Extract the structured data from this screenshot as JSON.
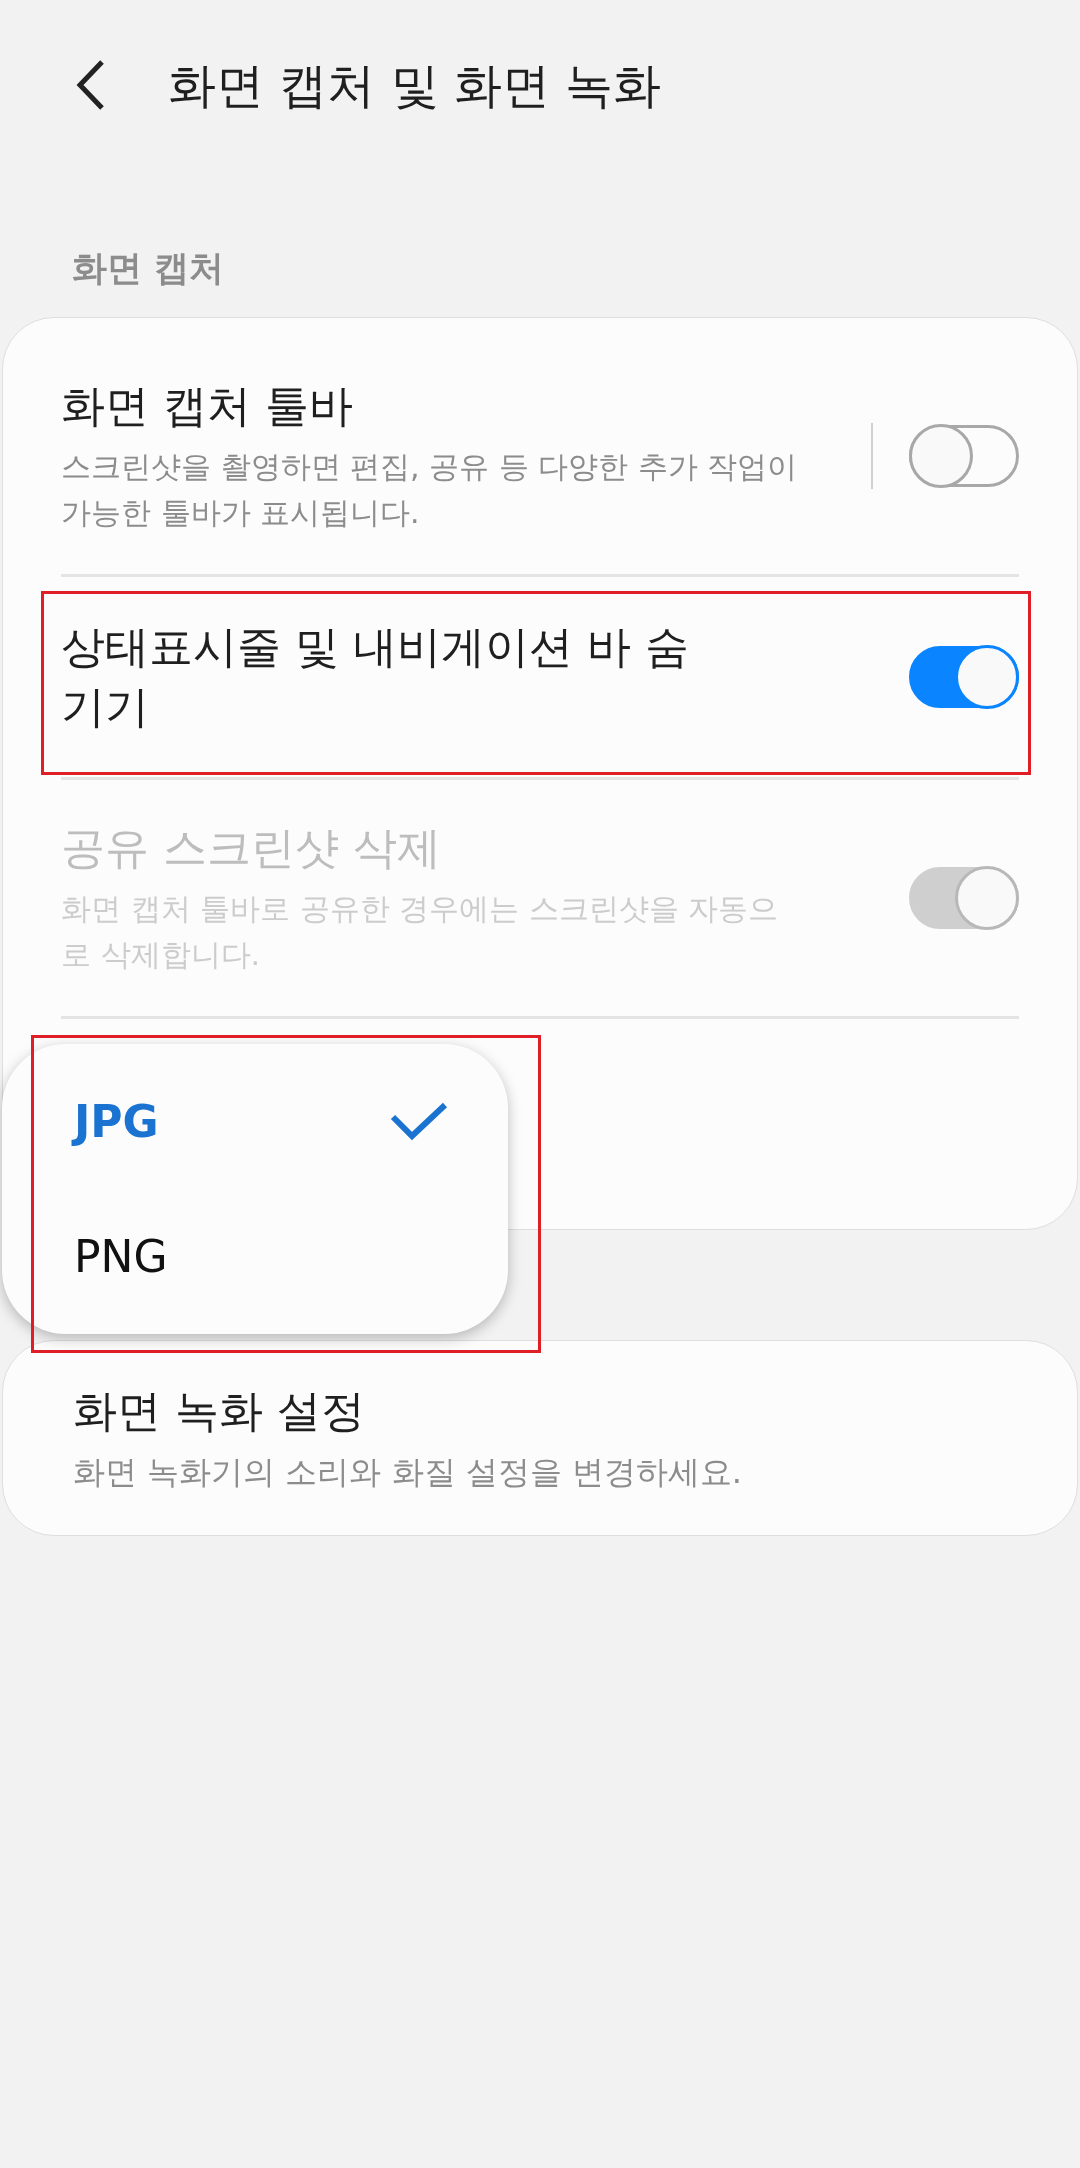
{
  "header": {
    "title": "화면 캡처 및 화면 녹화"
  },
  "sections": [
    {
      "label": "화면 캡처",
      "items": [
        {
          "title": "화면 캡처 툴바",
          "summary": "스크린샷을 촬영하면 편집, 공유 등 다양한 추가 작업이 가능한 툴바가 표시됩니다.",
          "on": false,
          "disabled": false,
          "highlighted": false,
          "divider": true
        },
        {
          "title": "상태표시줄 및 내비게이션 바 숨기기",
          "on": true,
          "disabled": false,
          "highlighted": true,
          "divider": false
        },
        {
          "title": "공유 스크린샷 삭제",
          "summary": "화면 캡처 툴바로 공유한 경우에는 스크린샷을 자동으로 삭제합니다.",
          "on": true,
          "disabled": true,
          "highlighted": false,
          "divider": false
        }
      ]
    },
    {
      "items": [
        {
          "title": "화면 녹화 설정",
          "summary": "화면 녹화기의 소리와 화질 설정을 변경하세요."
        }
      ]
    }
  ],
  "popup": {
    "highlighted": true,
    "options": [
      {
        "label": "JPG",
        "selected": true
      },
      {
        "label": "PNG",
        "selected": false
      }
    ]
  }
}
